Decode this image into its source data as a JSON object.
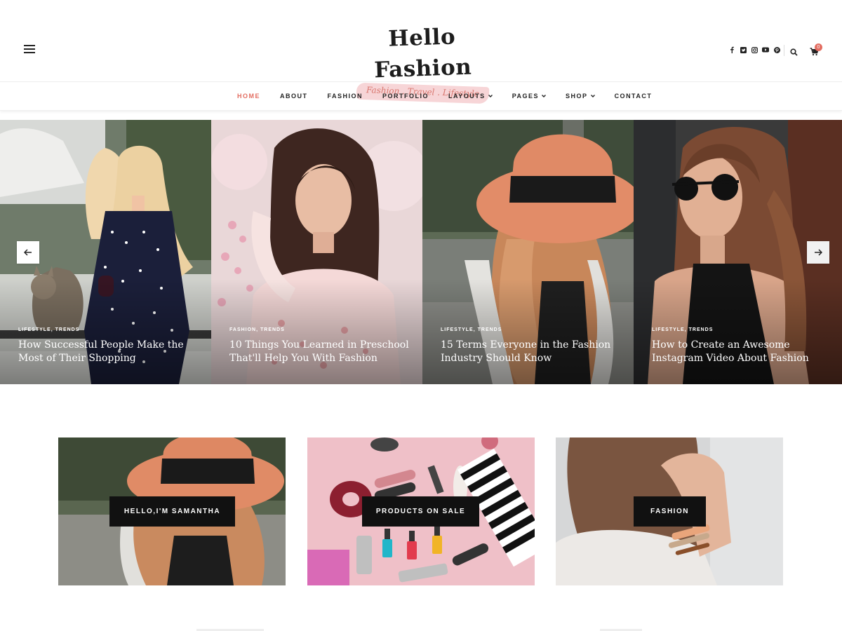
{
  "header": {
    "logo_title": "Hello Fashion",
    "logo_tagline": "Fashion . Travel . Lifestyle",
    "social_icons": [
      "facebook-icon",
      "twitter-icon",
      "instagram-icon",
      "youtube-icon",
      "pinterest-icon"
    ],
    "cart_count": "0"
  },
  "nav": {
    "items": [
      {
        "label": "HOME",
        "active": true,
        "has_dropdown": false
      },
      {
        "label": "ABOUT",
        "active": false,
        "has_dropdown": false
      },
      {
        "label": "FASHION",
        "active": false,
        "has_dropdown": false
      },
      {
        "label": "PORTFOLIO",
        "active": false,
        "has_dropdown": false
      },
      {
        "label": "LAYOUTS",
        "active": false,
        "has_dropdown": true
      },
      {
        "label": "PAGES",
        "active": false,
        "has_dropdown": true
      },
      {
        "label": "SHOP",
        "active": false,
        "has_dropdown": true
      },
      {
        "label": "CONTACT",
        "active": false,
        "has_dropdown": false
      }
    ]
  },
  "slider": {
    "slides": [
      {
        "categories": "LIFESTYLE,  TRENDS",
        "title": "How Successful People Make the Most of Their Shopping"
      },
      {
        "categories": "FASHION,  TRENDS",
        "title": "10 Things You Learned in Preschool That'll Help You With Fashion"
      },
      {
        "categories": "LIFESTYLE,  TRENDS",
        "title": "15 Terms Everyone in the Fashion Industry Should Know"
      },
      {
        "categories": "LIFESTYLE,  TRENDS",
        "title": "How to Create an Awesome Instagram Video About Fashion"
      }
    ]
  },
  "promos": [
    {
      "label": "HELLO,I'M SAMANTHA"
    },
    {
      "label": "PRODUCTS ON SALE"
    },
    {
      "label": "FASHION"
    }
  ],
  "colors": {
    "accent": "#e36e62",
    "label_bg": "#111111"
  }
}
